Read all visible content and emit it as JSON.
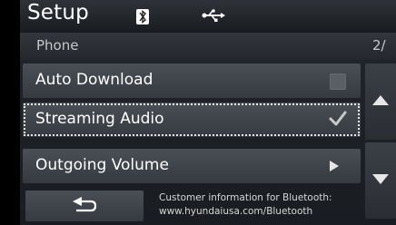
{
  "header": {
    "title": "Setup",
    "bluetooth_icon": "bluetooth-icon",
    "usb_icon": "usb-icon"
  },
  "subheader": {
    "title": "Phone",
    "page": "2/"
  },
  "menu": {
    "items": [
      {
        "label": "Auto Download",
        "control": "checkbox",
        "checked": false
      },
      {
        "label": "Streaming Audio",
        "control": "checkbox",
        "checked": true,
        "selected": true
      },
      {
        "label": "Outgoing Volume",
        "control": "arrow"
      }
    ]
  },
  "scroll": {
    "up_icon": "scroll-up-icon",
    "down_icon": "scroll-down-icon"
  },
  "footer": {
    "back_icon": "back-arrow-icon",
    "info_line1": "Customer information for Bluetooth:",
    "info_line2": "www.hyundaiusa.com/Bluetooth"
  },
  "colors": {
    "item_bg": "#4a4f56",
    "screen_bg": "#1d2025",
    "text": "#ffffff",
    "checkbox_unchecked": "#5a5f66",
    "check": "#c8c8c8"
  }
}
